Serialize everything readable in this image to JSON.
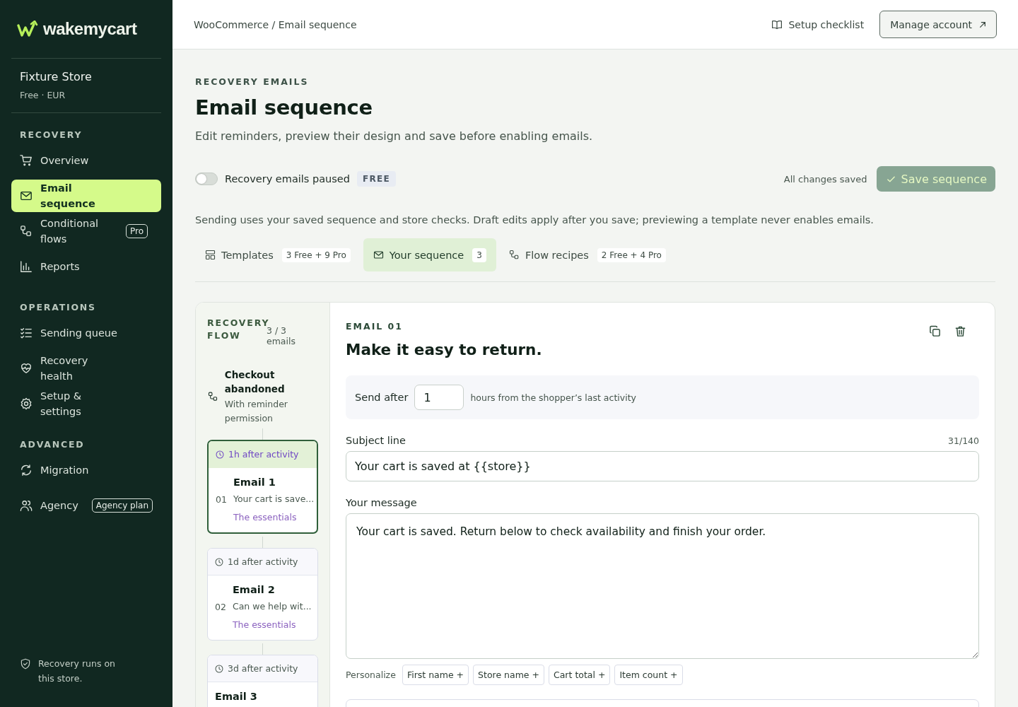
{
  "brand": {
    "name": "wakemycart"
  },
  "store": {
    "name": "Fixture Store",
    "meta": "Free · EUR"
  },
  "sidebar": {
    "sections": [
      {
        "title": "RECOVERY",
        "items": [
          {
            "label": "Overview",
            "selected": false
          },
          {
            "label": "Email sequence",
            "selected": true
          },
          {
            "label": "Conditional flows",
            "badge": "Pro",
            "selected": false
          },
          {
            "label": "Reports",
            "selected": false
          }
        ]
      },
      {
        "title": "OPERATIONS",
        "items": [
          {
            "label": "Sending queue",
            "selected": false
          },
          {
            "label": "Recovery health",
            "selected": false
          },
          {
            "label": "Setup & settings",
            "selected": false
          }
        ]
      },
      {
        "title": "ADVANCED",
        "items": [
          {
            "label": "Migration",
            "selected": false
          },
          {
            "label": "Agency",
            "badge": "Agency plan",
            "selected": false
          }
        ]
      }
    ],
    "footer": "Recovery runs on this store."
  },
  "header": {
    "breadcrumb": "WooCommerce / Email sequence",
    "checklist": "Setup checklist",
    "account_button": "Manage account"
  },
  "page": {
    "eyebrow": "RECOVERY EMAILS",
    "title": "Email sequence",
    "subtitle": "Edit reminders, preview their design and save before enabling emails.",
    "toggle": {
      "label": "Recovery emails paused",
      "on": false,
      "plan": "FREE"
    },
    "save_status": "All changes saved",
    "save_button": {
      "label": "Save sequence",
      "disabled": true
    },
    "notice": "Sending uses your saved sequence and store checks. Draft edits apply after you save; previewing a template never enables emails."
  },
  "tabs": [
    {
      "label": "Templates",
      "count": "3 Free + 9 Pro",
      "selected": false
    },
    {
      "label": "Your sequence",
      "count": "3",
      "selected": true
    },
    {
      "label": "Flow recipes",
      "count": "2 Free + 4 Pro",
      "selected": false
    }
  ],
  "flow": {
    "title": "RECOVERY FLOW",
    "count": "3 / 3 emails",
    "trigger": {
      "title": "Checkout abandoned",
      "note": "With reminder permission"
    },
    "emails": [
      {
        "timing": "1h after activity",
        "number": "01",
        "title": "Email 1",
        "subject": "Your cart is save...",
        "template": "The essentials",
        "selected": true
      },
      {
        "timing": "1d after activity",
        "number": "02",
        "title": "Email 2",
        "subject": "Can we help wit...",
        "template": "The essentials",
        "selected": false
      },
      {
        "timing": "3d after activity",
        "title": "Email 3",
        "selected": false
      }
    ]
  },
  "editor": {
    "eyebrow": "EMAIL 01",
    "title": "Make it easy to return.",
    "send_after": {
      "label": "Send after",
      "value": "1",
      "suffix": "hours from the shopper’s last activity"
    },
    "subject": {
      "label": "Subject line",
      "counter": "31/140",
      "value": "Your cart is saved at {{store}}"
    },
    "message": {
      "label": "Your message",
      "value": "Your cart is saved. Return below to check availability and finish your order."
    },
    "personalize": {
      "label": "Personalize",
      "tokens": [
        "First name +",
        "Store name +",
        "Cart total +",
        "Item count +"
      ]
    }
  }
}
